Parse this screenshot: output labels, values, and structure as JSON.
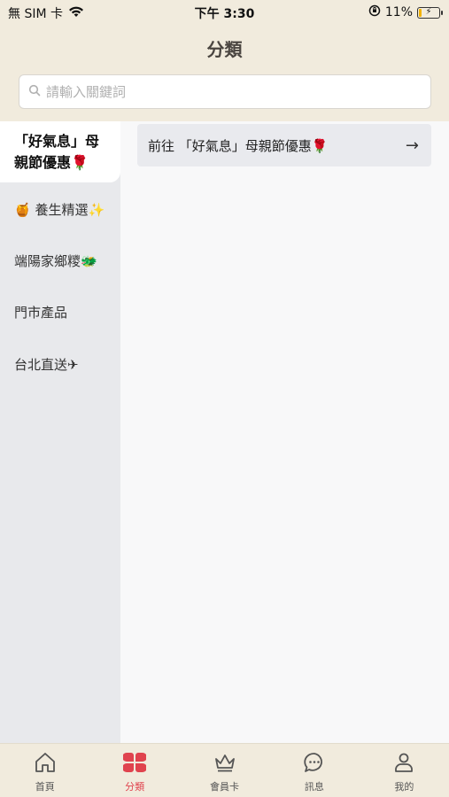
{
  "status_bar": {
    "carrier": "無 SIM 卡",
    "time": "下午 3:30",
    "battery": "11%"
  },
  "header": {
    "title": "分類"
  },
  "search": {
    "placeholder": "請輸入關鍵詞"
  },
  "sidebar": {
    "items": [
      {
        "label": "「好氣息」母親節優惠🌹",
        "active": true
      },
      {
        "label": "🍯 養生精選✨",
        "active": false
      },
      {
        "label": "端陽家鄉糭🐲",
        "active": false
      },
      {
        "label": "門市產品",
        "active": false
      },
      {
        "label": "台北直送✈",
        "active": false
      }
    ]
  },
  "content": {
    "goto_label": "前往 「好氣息」母親節優惠🌹",
    "arrow": "→"
  },
  "tabbar": {
    "items": [
      {
        "label": "首頁",
        "icon": "home-icon",
        "active": false
      },
      {
        "label": "分類",
        "icon": "category-icon",
        "active": true
      },
      {
        "label": "會員卡",
        "icon": "crown-icon",
        "active": false
      },
      {
        "label": "訊息",
        "icon": "message-icon",
        "active": false
      },
      {
        "label": "我的",
        "icon": "user-icon",
        "active": false
      }
    ],
    "accent_color": "#e0434e"
  }
}
